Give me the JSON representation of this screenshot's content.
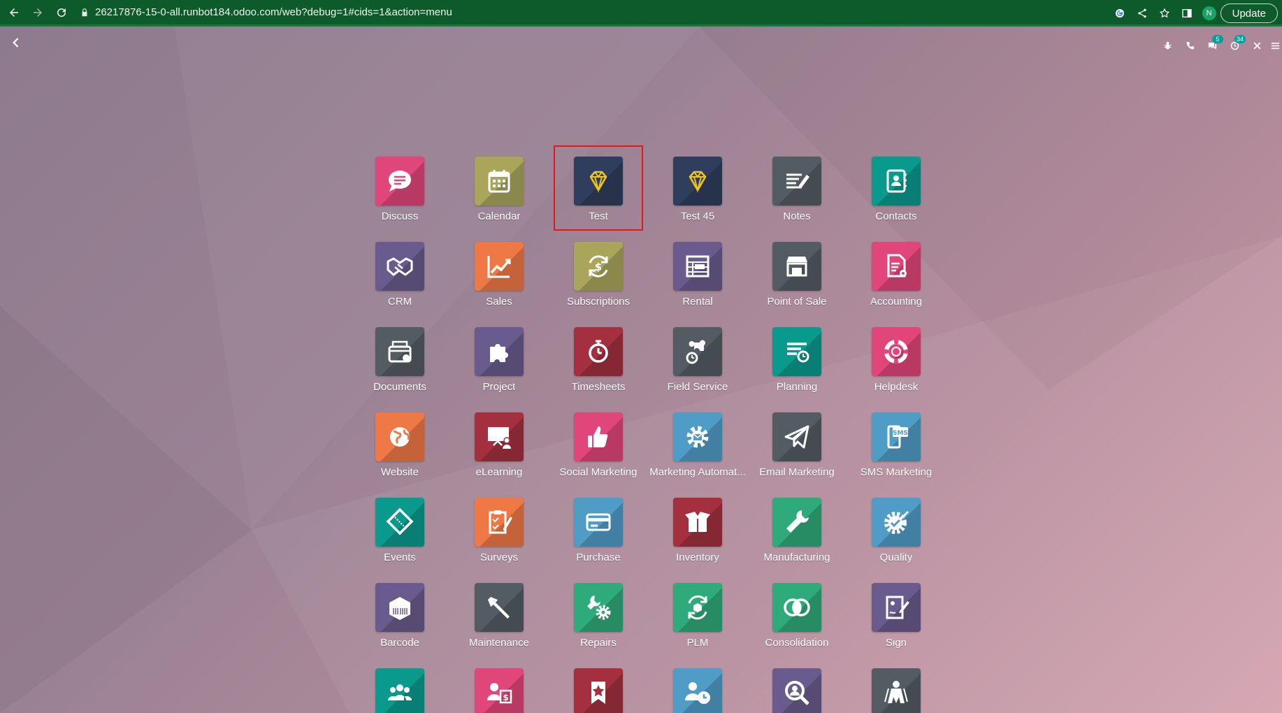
{
  "browser": {
    "url": "26217876-15-0-all.runbot184.odoo.com/web?debug=1#cids=1&action=menu",
    "profile_initial": "N",
    "update_label": "Update"
  },
  "systray": {
    "messages_badge": "5",
    "activities_badge": "34"
  },
  "apps": [
    {
      "label": "Discuss",
      "icon": "chat-bubble-icon",
      "color": "#e0467a"
    },
    {
      "label": "Calendar",
      "icon": "calendar-icon",
      "color": "#a9a65b"
    },
    {
      "label": "Test",
      "icon": "diamond-icon",
      "color": "#2f3e5c",
      "selected": true
    },
    {
      "label": "Test 45",
      "icon": "diamond-icon",
      "color": "#2f3e5c"
    },
    {
      "label": "Notes",
      "icon": "notes-icon",
      "color": "#545c63"
    },
    {
      "label": "Contacts",
      "icon": "address-book-icon",
      "color": "#0a9a8d"
    },
    {
      "label": "CRM",
      "icon": "handshake-icon",
      "color": "#6a5b8e"
    },
    {
      "label": "Sales",
      "icon": "trend-chart-icon",
      "color": "#ef7946"
    },
    {
      "label": "Subscriptions",
      "icon": "recurring-dollar-icon",
      "color": "#a9a65b"
    },
    {
      "label": "Rental",
      "icon": "rental-grid-icon",
      "color": "#6a5b8e"
    },
    {
      "label": "Point of Sale",
      "icon": "shop-icon",
      "color": "#545c63"
    },
    {
      "label": "Accounting",
      "icon": "invoice-gear-icon",
      "color": "#e0467a"
    },
    {
      "label": "Documents",
      "icon": "document-box-icon",
      "color": "#545c63"
    },
    {
      "label": "Project",
      "icon": "puzzle-icon",
      "color": "#6a5b8e"
    },
    {
      "label": "Timesheets",
      "icon": "stopwatch-icon",
      "color": "#a4303f"
    },
    {
      "label": "Field Service",
      "icon": "field-service-icon",
      "color": "#545c63"
    },
    {
      "label": "Planning",
      "icon": "planning-icon",
      "color": "#0a9a8d"
    },
    {
      "label": "Helpdesk",
      "icon": "lifebuoy-icon",
      "color": "#e0467a"
    },
    {
      "label": "Website",
      "icon": "globe-icon",
      "color": "#ef7946"
    },
    {
      "label": "eLearning",
      "icon": "presentation-icon",
      "color": "#a4303f"
    },
    {
      "label": "Social Marketing",
      "icon": "thumbs-up-icon",
      "color": "#e0467a"
    },
    {
      "label": "Marketing Automat...",
      "icon": "gear-mail-icon",
      "color": "#4f9cc6"
    },
    {
      "label": "Email Marketing",
      "icon": "paper-plane-icon",
      "color": "#545c63"
    },
    {
      "label": "SMS Marketing",
      "icon": "sms-phone-icon",
      "color": "#4f9cc6"
    },
    {
      "label": "Events",
      "icon": "ticket-icon",
      "color": "#0a9a8d"
    },
    {
      "label": "Surveys",
      "icon": "clipboard-check-icon",
      "color": "#ef7946"
    },
    {
      "label": "Purchase",
      "icon": "credit-card-icon",
      "color": "#4f9cc6"
    },
    {
      "label": "Inventory",
      "icon": "open-box-icon",
      "color": "#a4303f"
    },
    {
      "label": "Manufacturing",
      "icon": "wrench-icon",
      "color": "#2faa7a"
    },
    {
      "label": "Quality",
      "icon": "quality-badge-icon",
      "color": "#4f9cc6"
    },
    {
      "label": "Barcode",
      "icon": "barcode-box-icon",
      "color": "#6a5b8e"
    },
    {
      "label": "Maintenance",
      "icon": "hammer-icon",
      "color": "#545c63"
    },
    {
      "label": "Repairs",
      "icon": "wrench-gear-icon",
      "color": "#2faa7a"
    },
    {
      "label": "PLM",
      "icon": "cycle-box-icon",
      "color": "#2faa7a"
    },
    {
      "label": "Consolidation",
      "icon": "overlap-circles-icon",
      "color": "#2faa7a"
    },
    {
      "label": "Sign",
      "icon": "sign-document-icon",
      "color": "#6a5b8e"
    },
    {
      "label": "Employees",
      "icon": "people-group-icon",
      "color": "#0a9a8d"
    },
    {
      "label": "Payroll",
      "icon": "person-dollar-icon",
      "color": "#e0467a"
    },
    {
      "label": "Appraisals",
      "icon": "star-ribbon-icon",
      "color": "#a4303f"
    },
    {
      "label": "Attendances",
      "icon": "person-clock-icon",
      "color": "#4f9cc6"
    },
    {
      "label": "Recruitment",
      "icon": "magnify-person-icon",
      "color": "#6a5b8e"
    },
    {
      "label": "Referrals",
      "icon": "referral-hero-icon",
      "color": "#545c63"
    }
  ]
}
